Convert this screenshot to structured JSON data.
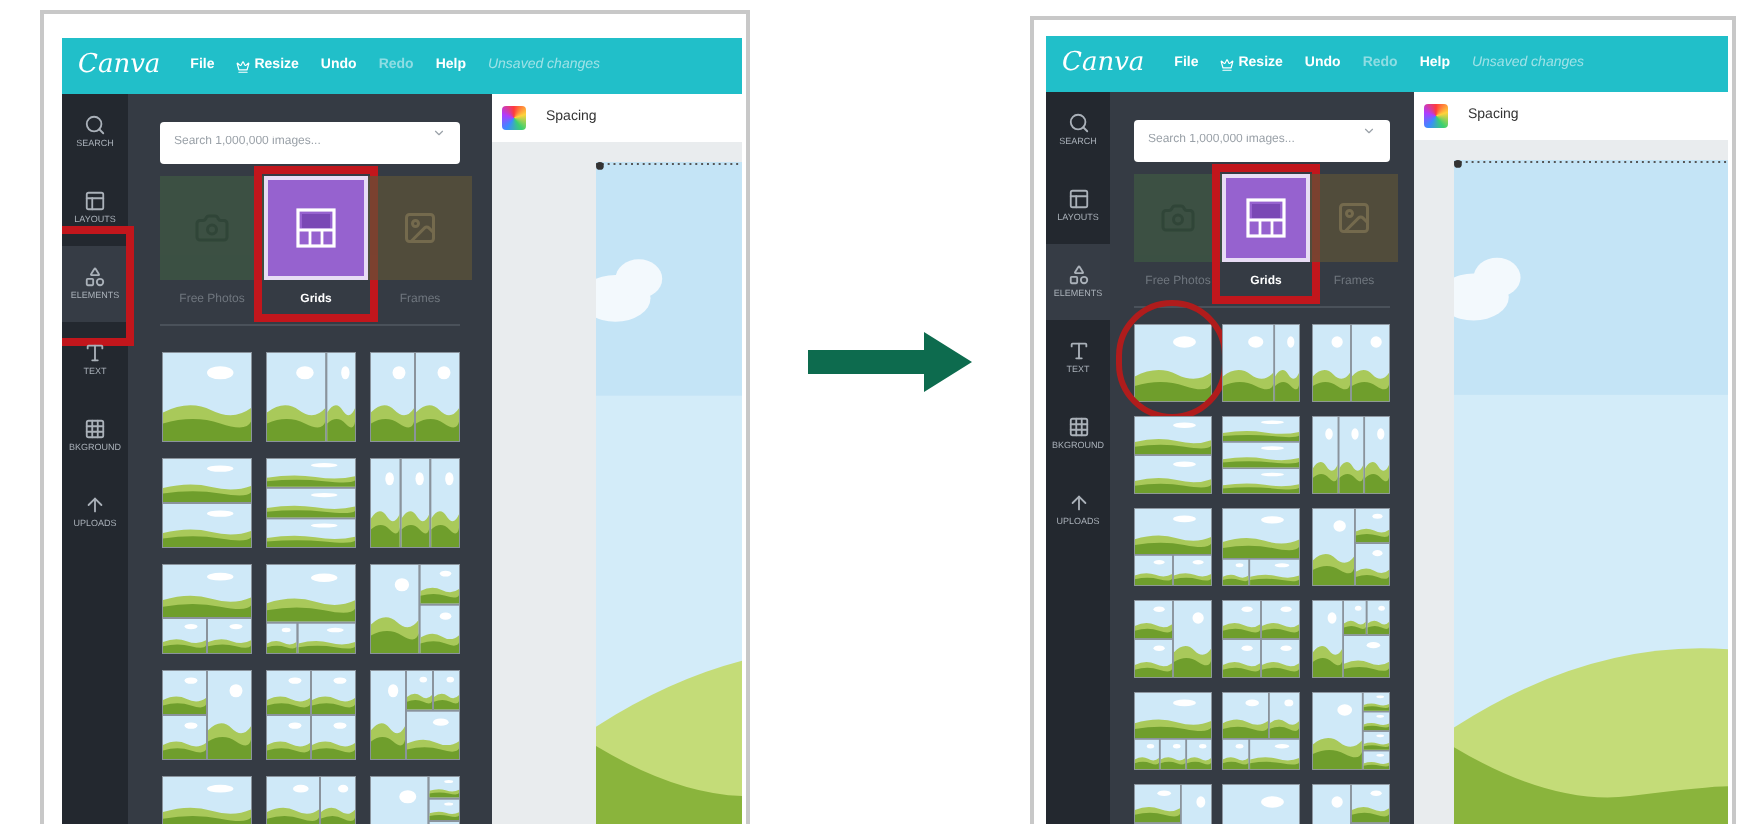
{
  "screens": [
    {
      "logo": "Canva",
      "menu": [
        {
          "label": "File",
          "kind": "plain",
          "disabled": false
        },
        {
          "label": "Resize",
          "kind": "crown",
          "disabled": false
        },
        {
          "label": "Undo",
          "kind": "plain",
          "disabled": false
        },
        {
          "label": "Redo",
          "kind": "plain",
          "disabled": true
        },
        {
          "label": "Help",
          "kind": "plain",
          "disabled": false
        }
      ],
      "status": "Unsaved changes",
      "sidebar": [
        {
          "label": "SEARCH",
          "kind": "search",
          "selected": false,
          "highlighted": false
        },
        {
          "label": "LAYOUTS",
          "kind": "layouts",
          "selected": false,
          "highlighted": false
        },
        {
          "label": "ELEMENTS",
          "kind": "elements",
          "selected": true,
          "highlighted": true
        },
        {
          "label": "TEXT",
          "kind": "text",
          "selected": false,
          "highlighted": false
        },
        {
          "label": "BKGROUND",
          "kind": "background",
          "selected": false,
          "highlighted": false
        },
        {
          "label": "UPLOADS",
          "kind": "uploads",
          "selected": false,
          "highlighted": false
        }
      ],
      "search": {
        "placeholder": "Search 1,000,000 images..."
      },
      "tabs": [
        {
          "label": "Free Photos",
          "kind": "photos",
          "selected": false,
          "highlighted": false
        },
        {
          "label": "Grids",
          "kind": "grids",
          "selected": true,
          "highlighted": true
        },
        {
          "label": "Frames",
          "kind": "frames",
          "selected": false,
          "highlighted": false
        }
      ],
      "first_grid_circled": false,
      "document_title": "Spacing"
    },
    {
      "logo": "Canva",
      "menu": [
        {
          "label": "File",
          "kind": "plain",
          "disabled": false
        },
        {
          "label": "Resize",
          "kind": "crown",
          "disabled": false
        },
        {
          "label": "Undo",
          "kind": "plain",
          "disabled": false
        },
        {
          "label": "Redo",
          "kind": "plain",
          "disabled": true
        },
        {
          "label": "Help",
          "kind": "plain",
          "disabled": false
        }
      ],
      "status": "Unsaved changes",
      "sidebar": [
        {
          "label": "SEARCH",
          "kind": "search",
          "selected": false,
          "highlighted": false
        },
        {
          "label": "LAYOUTS",
          "kind": "layouts",
          "selected": false,
          "highlighted": false
        },
        {
          "label": "ELEMENTS",
          "kind": "elements",
          "selected": true,
          "highlighted": false
        },
        {
          "label": "TEXT",
          "kind": "text",
          "selected": false,
          "highlighted": false
        },
        {
          "label": "BKGROUND",
          "kind": "background",
          "selected": false,
          "highlighted": false
        },
        {
          "label": "UPLOADS",
          "kind": "uploads",
          "selected": false,
          "highlighted": false
        }
      ],
      "search": {
        "placeholder": "Search 1,000,000 images..."
      },
      "tabs": [
        {
          "label": "Free Photos",
          "kind": "photos",
          "selected": false,
          "highlighted": false
        },
        {
          "label": "Grids",
          "kind": "grids",
          "selected": true,
          "highlighted": true
        },
        {
          "label": "Frames",
          "kind": "frames",
          "selected": false,
          "highlighted": false
        }
      ],
      "first_grid_circled": true,
      "document_title": "Spacing"
    }
  ]
}
